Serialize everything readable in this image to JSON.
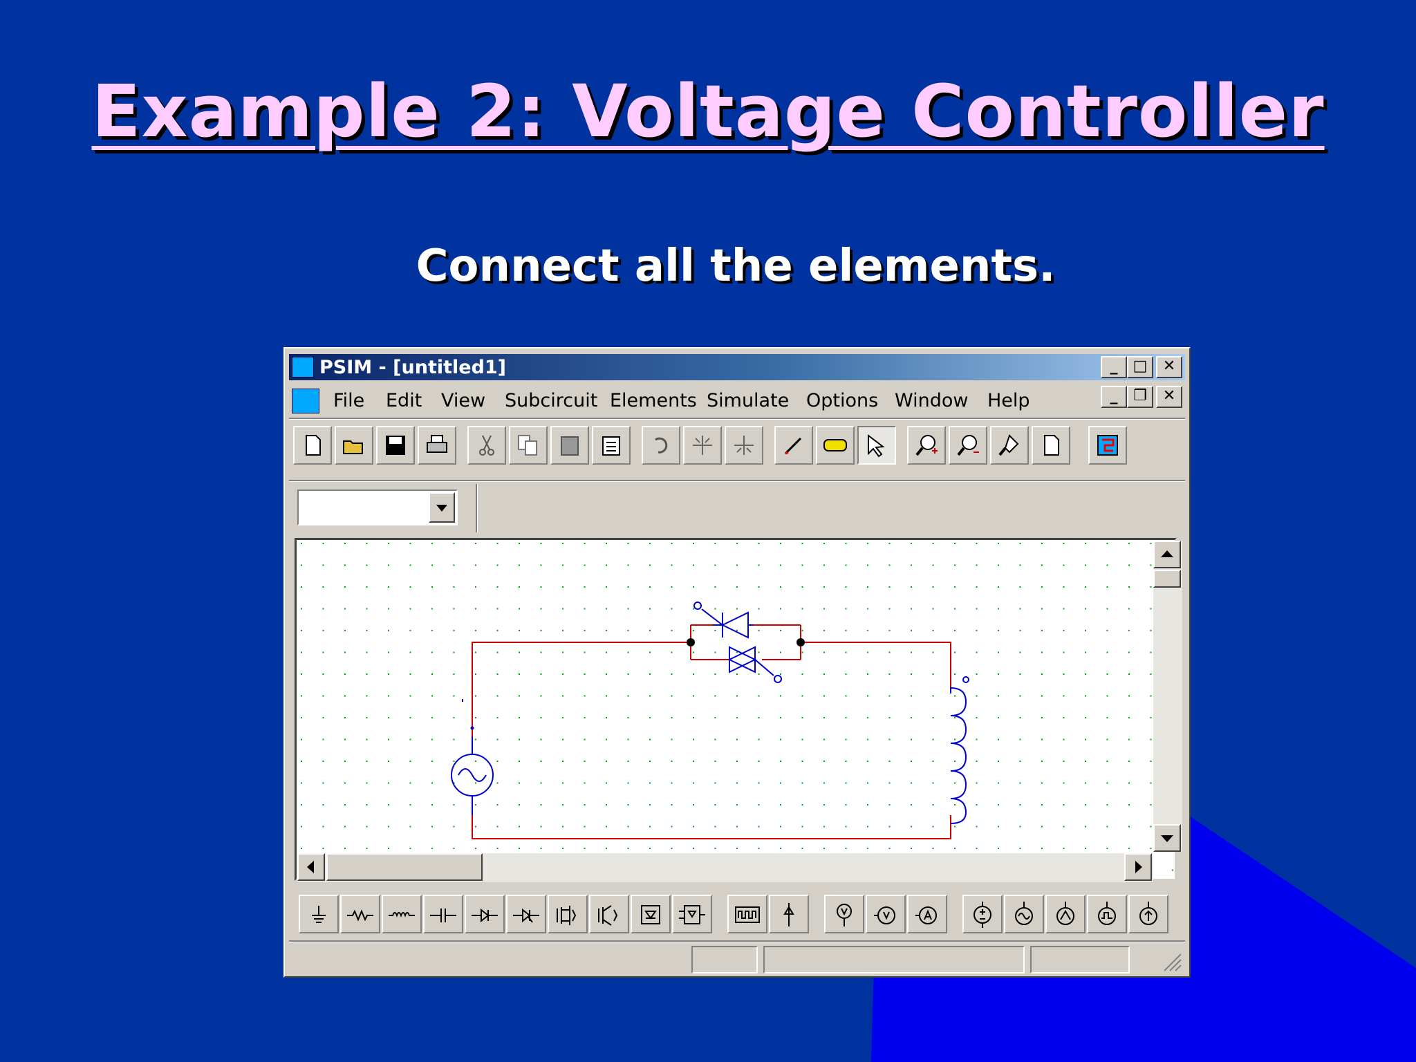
{
  "slide": {
    "title": "Example 2: Voltage Controller",
    "subtitle": "Connect all the elements."
  },
  "window": {
    "title": "PSIM - [untitled1]",
    "buttons": {
      "minimize": "_",
      "maximize": "□",
      "close": "✕"
    },
    "doc_buttons": {
      "minimize": "_",
      "restore": "❐",
      "close": "✕"
    }
  },
  "menu": [
    "File",
    "Edit",
    "View",
    "Subcircuit",
    "Elements",
    "Simulate",
    "Options",
    "Window",
    "Help"
  ],
  "toolbar_icons": [
    "new-file-icon",
    "open-folder-icon",
    "save-disk-icon",
    "print-icon",
    "cut-icon",
    "copy-icon",
    "paste-icon",
    "clipboard-icon",
    "rotate-icon",
    "flip-lr-icon",
    "flip-tb-icon",
    "wire-pencil-icon",
    "label-icon",
    "pointer-arrow-icon",
    "zoom-in-icon",
    "zoom-out-icon",
    "zoom-fit-icon",
    "page-icon",
    "simview-icon"
  ],
  "element_icons": [
    "ground-icon",
    "resistor-icon",
    "inductor-icon",
    "capacitor-icon",
    "diode-icon",
    "thyristor-icon",
    "mosfet-icon",
    "igbt-icon",
    "gto-icon",
    "switch-icon",
    "gating-block-icon",
    "voltage-probe-icon",
    "voltmeter-icon",
    "dc-voltmeter-icon",
    "ammeter-icon",
    "dc-source-icon",
    "ac-source-icon",
    "sine-source-icon",
    "square-source-icon",
    "current-source-icon"
  ],
  "combo": {
    "value": ""
  },
  "colors": {
    "wire": "#cc0000",
    "component": "#0000cc",
    "grid": "#00aa00",
    "slide_bg": "#0033a0"
  }
}
